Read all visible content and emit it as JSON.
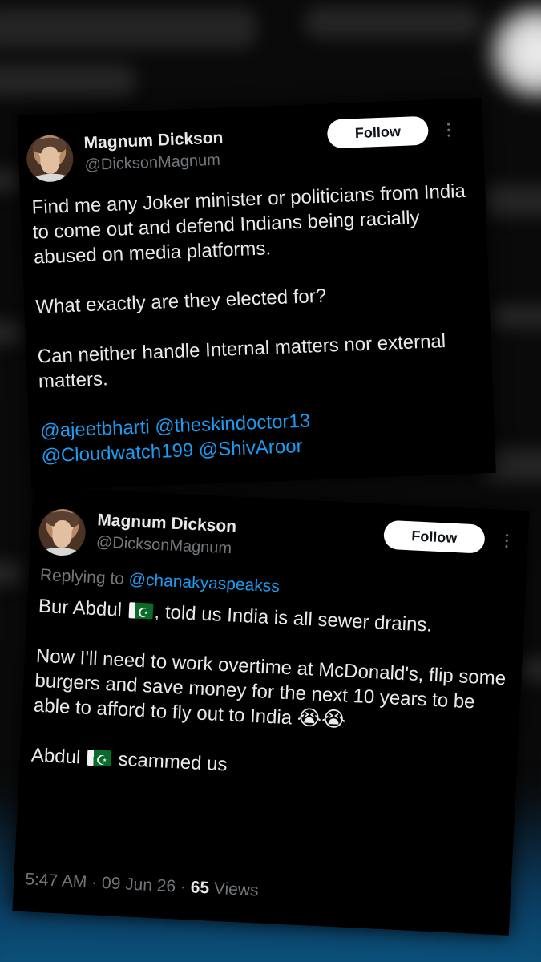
{
  "tweet_1": {
    "author_name": "Magnum Dickson",
    "author_handle": "@DicksonMagnum",
    "follow_label": "Follow",
    "paragraphs": [
      "Find me any Joker minister or politicians from India to come out and defend Indians being racially abused on media platforms.",
      "What exactly are they elected for?",
      "Can neither handle Internal matters nor external matters."
    ],
    "mentions": [
      "@ajeetbharti",
      "@theskindoctor13",
      "@Cloudwatch199",
      "@ShivAroor"
    ]
  },
  "tweet_2": {
    "author_name": "Magnum Dickson",
    "author_handle": "@DicksonMagnum",
    "follow_label": "Follow",
    "replying_prefix": "Replying to",
    "replying_to": "@chanakyaspeakss",
    "p1_a": "Bur Abdul",
    "p1_b": ", told us India is all sewer drains.",
    "p2": "Now I'll need to work overtime at McDonald's, flip some burgers and save money for the next 10 years to be able to afford to fly out to India",
    "p2_emoji": "😭😭",
    "p3_a": "Abdul",
    "p3_b": "scammed us",
    "time": "5:47 AM · 09 Jun 26 · ",
    "views_count": "65",
    "views_label": " Views"
  },
  "colors": {
    "background": "#000000",
    "text": "#e7e9ea",
    "muted": "#71767b",
    "link": "#1d9bf0",
    "follow_bg": "#ffffff"
  },
  "icons": [
    "more-options-icon",
    "pakistan-flag-icon",
    "loudly-crying-face-emoji"
  ]
}
